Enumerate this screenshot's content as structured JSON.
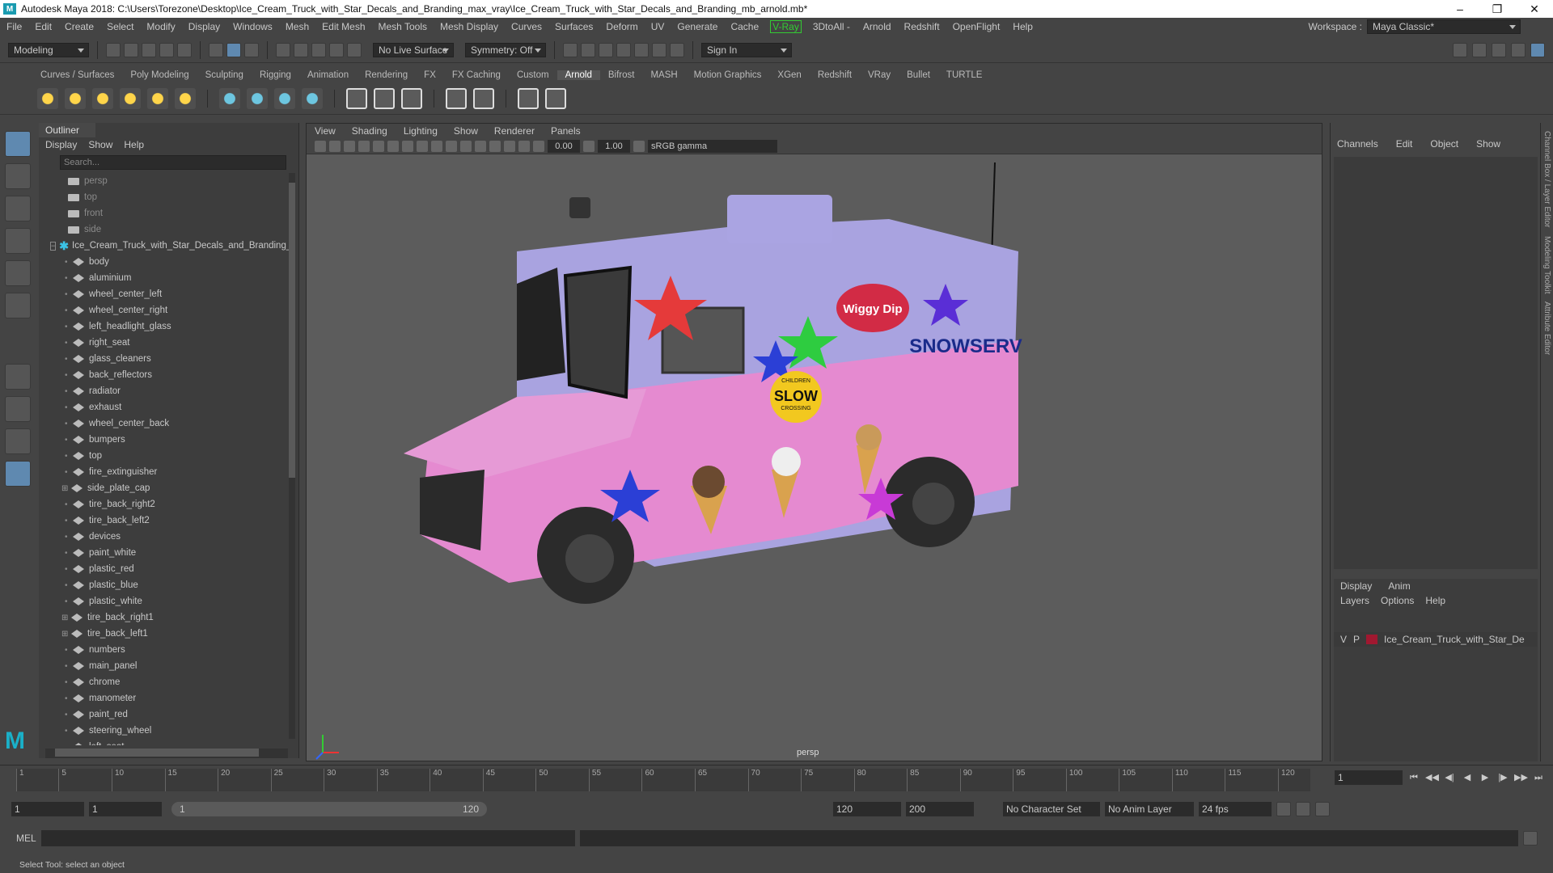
{
  "window": {
    "title": "Autodesk Maya 2018: C:\\Users\\Torezone\\Desktop\\Ice_Cream_Truck_with_Star_Decals_and_Branding_max_vray\\Ice_Cream_Truck_with_Star_Decals_and_Branding_mb_arnold.mb*"
  },
  "menu": [
    "File",
    "Edit",
    "Create",
    "Select",
    "Modify",
    "Display",
    "Windows",
    "Mesh",
    "Edit Mesh",
    "Mesh Tools",
    "Mesh Display",
    "Curves",
    "Surfaces",
    "Deform",
    "UV",
    "Generate",
    "Cache"
  ],
  "menu_vray": "V-Ray",
  "menu_after": [
    "3DtoAll -",
    "Arnold",
    "Redshift",
    "OpenFlight",
    "Help"
  ],
  "workspace": {
    "label": "Workspace :",
    "value": "Maya Classic*"
  },
  "status": {
    "mode": "Modeling",
    "live_surface": "No Live Surface",
    "symmetry": "Symmetry: Off",
    "sign_in": "Sign In"
  },
  "shelf_tabs": [
    "Curves / Surfaces",
    "Poly Modeling",
    "Sculpting",
    "Rigging",
    "Animation",
    "Rendering",
    "FX",
    "FX Caching",
    "Custom",
    "Arnold",
    "Bifrost",
    "MASH",
    "Motion Graphics",
    "XGen",
    "Redshift",
    "VRay",
    "Bullet",
    "TURTLE"
  ],
  "shelf_active": "Arnold",
  "outliner": {
    "tab": "Outliner",
    "menu": [
      "Display",
      "Show",
      "Help"
    ],
    "search_placeholder": "Search...",
    "cameras": [
      "persp",
      "top",
      "front",
      "side"
    ],
    "group": "Ice_Cream_Truck_with_Star_Decals_and_Branding_",
    "items": [
      "body",
      "aluminium",
      "wheel_center_left",
      "wheel_center_right",
      "left_headlight_glass",
      "right_seat",
      "glass_cleaners",
      "back_reflectors",
      "radiator",
      "exhaust",
      "wheel_center_back",
      "bumpers",
      "top",
      "fire_extinguisher",
      "side_plate_cap",
      "tire_back_right2",
      "tire_back_left2",
      "devices",
      "paint_white",
      "plastic_red",
      "plastic_blue",
      "plastic_white",
      "tire_back_right1",
      "tire_back_left1",
      "numbers",
      "main_panel",
      "chrome",
      "manometer",
      "paint_red",
      "steering_wheel",
      "left_seat"
    ],
    "expandable": [
      "side_plate_cap",
      "tire_back_right1",
      "tire_back_left1"
    ]
  },
  "viewport": {
    "menu": [
      "View",
      "Shading",
      "Lighting",
      "Show",
      "Renderer",
      "Panels"
    ],
    "exposure": "0.00",
    "gamma_val": "1.00",
    "color_space": "sRGB gamma",
    "camera": "persp"
  },
  "truck": {
    "brand1": "Wiggy Dip",
    "brand2": "SNOWSERV",
    "sign_top": "CHILDREN",
    "sign_main": "SLOW",
    "sign_bottom": "CROSSING",
    "colors": {
      "body": "#e58ad0",
      "roof": "#a9a3e0",
      "tire": "#2b2b2b"
    }
  },
  "channel": {
    "menu": [
      "Channels",
      "Edit",
      "Object",
      "Show"
    ]
  },
  "layers": {
    "tabs": [
      "Display",
      "Anim"
    ],
    "menu": [
      "Layers",
      "Options",
      "Help"
    ],
    "v": "V",
    "p": "P",
    "name": "Ice_Cream_Truck_with_Star_De"
  },
  "side_tabs": [
    "Channel Box / Layer Editor",
    "Modeling Toolkit",
    "Attribute Editor"
  ],
  "timeline": {
    "ticks": [
      "1",
      "5",
      "10",
      "15",
      "20",
      "25",
      "30",
      "35",
      "40",
      "45",
      "50",
      "55",
      "60",
      "65",
      "70",
      "75",
      "80",
      "85",
      "90",
      "95",
      "100",
      "105",
      "110",
      "115",
      "120"
    ],
    "current": "1"
  },
  "range": {
    "start": "1",
    "anim_start": "1",
    "slider_start": "1",
    "slider_end": "120",
    "end": "120",
    "anim_end": "200",
    "char_set": "No Character Set",
    "anim_layer": "No Anim Layer",
    "fps": "24 fps"
  },
  "mel": {
    "label": "MEL"
  },
  "help_line": "Select Tool: select an object"
}
